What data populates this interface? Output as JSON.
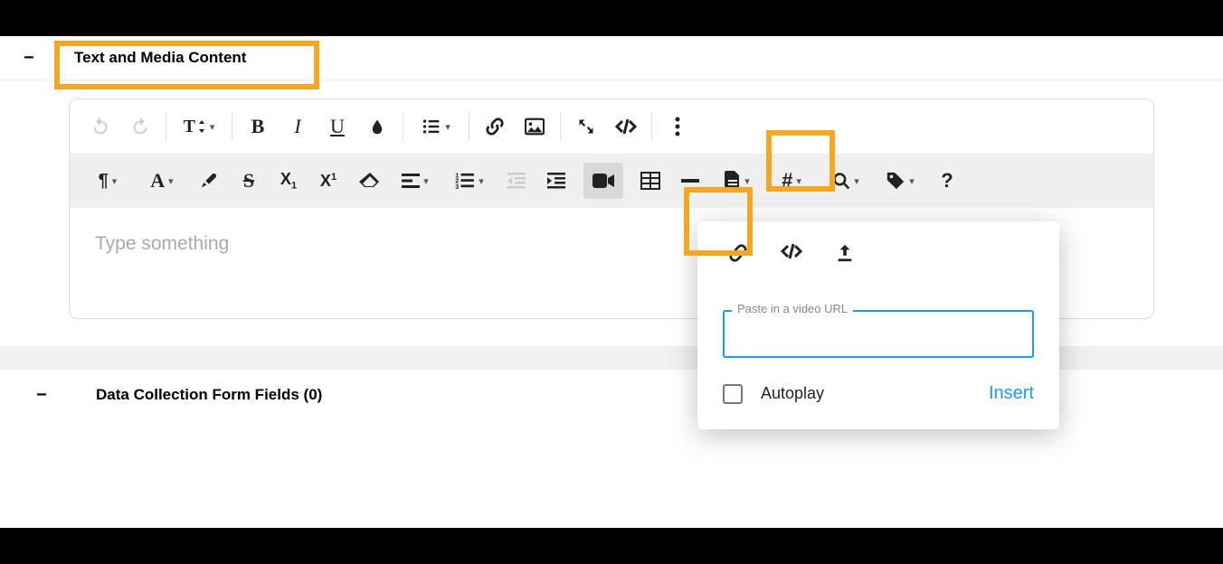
{
  "sections": {
    "text_media": {
      "title": "Text and Media Content"
    },
    "form_fields": {
      "title": "Data Collection Form Fields (0)"
    }
  },
  "editor": {
    "placeholder": "Type something"
  },
  "popup": {
    "field_label": "Paste in a video URL",
    "autoplay_label": "Autoplay",
    "insert_label": "Insert"
  },
  "icons": {
    "undo": "undo",
    "redo": "redo",
    "textsize": "T",
    "bold": "B",
    "italic": "I",
    "underline": "U",
    "color": "drop",
    "list": "list",
    "link": "link",
    "image": "image",
    "fullscreen": "expand",
    "code": "code",
    "more": "more",
    "paragraph": "¶",
    "font": "A",
    "brush": "brush",
    "strike": "S",
    "sub": "X₁",
    "sup": "X¹",
    "eraser": "eraser",
    "alignleft": "align",
    "ol": "ol",
    "outdent": "outdent",
    "indent": "indent",
    "video": "video",
    "table": "table",
    "hr": "hr",
    "file": "file",
    "hash": "#",
    "search": "search",
    "tag": "tag",
    "help": "?"
  }
}
